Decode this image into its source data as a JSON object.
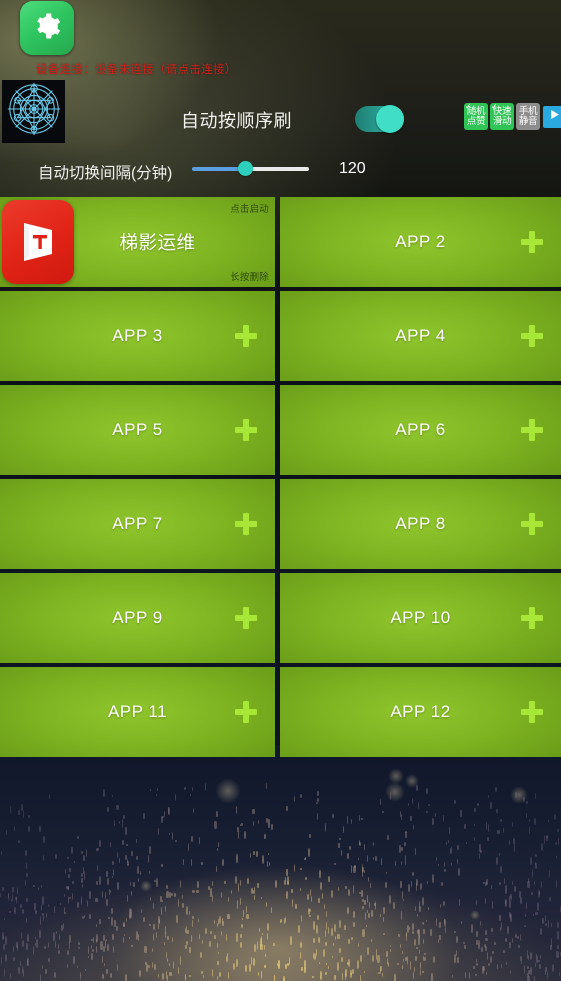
{
  "wallpaper": {
    "top_tone": "#20201a",
    "bottom_tone": "#141b2e",
    "accent_sparkle": "#e6d7aa"
  },
  "topbar": {
    "gear_app": {
      "name": "settings-gear-app",
      "icon": "gear-icon",
      "color": "#2ec45f"
    },
    "status_text": "设备连接：设备未连接（请点击连接）",
    "status_color": "#d2201a",
    "compass_app": {
      "name": "compass-app",
      "icon": "compass-icon",
      "bg": "#08090c"
    },
    "auto_title": "自动按顺序刷",
    "toggle": {
      "state": "on",
      "color": "#2fc0ae",
      "knob_color": "#41dec7"
    },
    "badges": [
      {
        "line1": "随机",
        "line2": "点赞",
        "state": "on",
        "color": "#2fc455",
        "check": "✓"
      },
      {
        "line1": "快速",
        "line2": "滑动",
        "state": "on",
        "color": "#2fc455",
        "check": "✓"
      },
      {
        "line1": "手机",
        "line2": "静音",
        "state": "off",
        "color": "#8d8d8d",
        "check": ""
      }
    ],
    "play_button": {
      "label": "play-icon",
      "color": "#2aa9e0"
    }
  },
  "slider": {
    "label": "自动切换间隔(分钟)",
    "value": "120",
    "percent": 45,
    "fill_color": "#5b9fe0",
    "track_color": "#e9e9e9",
    "thumb_color": "#2dd0bd"
  },
  "grid": {
    "hint_tap": "点击启动",
    "hint_hold": "长按删除",
    "card_color": "#7fb522",
    "plus_color": "#a8e638",
    "cards": [
      {
        "label": "梯影运维",
        "filled": true,
        "icon": "tiyingyunwei-app-icon",
        "icon_color": "#e02316"
      },
      {
        "label": "APP 2",
        "filled": false
      },
      {
        "label": "APP 3",
        "filled": false
      },
      {
        "label": "APP 4",
        "filled": false
      },
      {
        "label": "APP 5",
        "filled": false
      },
      {
        "label": "APP 6",
        "filled": false
      },
      {
        "label": "APP 7",
        "filled": false
      },
      {
        "label": "APP 8",
        "filled": false
      },
      {
        "label": "APP 9",
        "filled": false
      },
      {
        "label": "APP 10",
        "filled": false
      },
      {
        "label": "APP 11",
        "filled": false
      },
      {
        "label": "APP 12",
        "filled": false
      }
    ]
  }
}
